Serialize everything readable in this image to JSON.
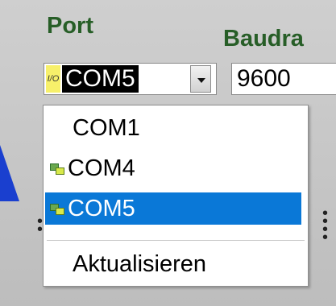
{
  "port": {
    "label": "Port",
    "io_tag": "I/O",
    "selected_value": "COM5"
  },
  "baudrate": {
    "label_visible": "Baudra",
    "value": "9600"
  },
  "dropdown": {
    "items": [
      {
        "label": "COM1",
        "icon": null,
        "selected": false
      },
      {
        "label": "COM4",
        "icon": "serial-port-icon",
        "selected": false
      },
      {
        "label": "COM5",
        "icon": "serial-port-icon",
        "selected": true
      }
    ],
    "refresh_label": "Aktualisieren"
  },
  "colors": {
    "label_green": "#275e27",
    "selection_blue": "#0a78d7",
    "io_tag_yellow": "#f7f06a"
  }
}
